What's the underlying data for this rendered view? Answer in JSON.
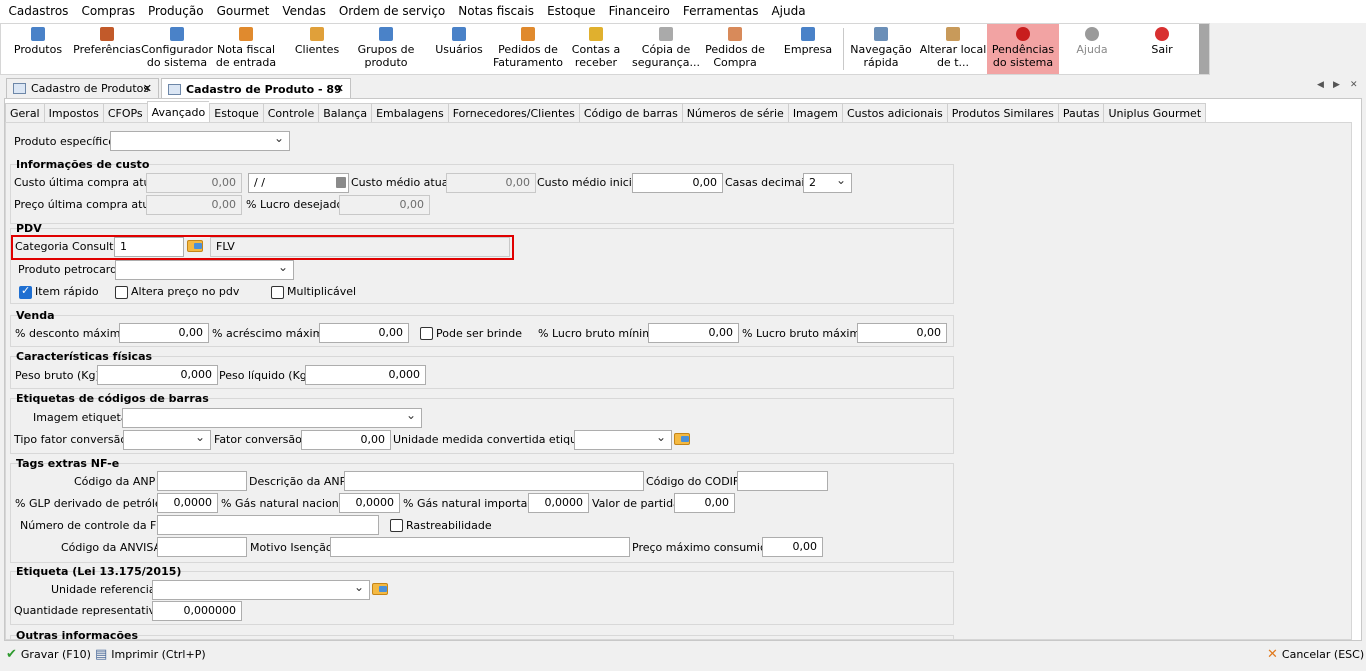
{
  "menu": [
    "Cadastros",
    "Compras",
    "Produção",
    "Gourmet",
    "Vendas",
    "Ordem de serviço",
    "Notas fiscais",
    "Estoque",
    "Financeiro",
    "Ferramentas",
    "Ajuda"
  ],
  "toolbar": [
    {
      "label": "Produtos",
      "icon": "products-icon",
      "color": "#4a82c8"
    },
    {
      "label": "Preferências",
      "icon": "preferences-icon",
      "color": "#c25a2a"
    },
    {
      "label": "Configurador\ndo sistema",
      "icon": "configurator-icon",
      "color": "#4a82c8"
    },
    {
      "label": "Nota fiscal\nde entrada",
      "icon": "invoice-icon",
      "color": "#e08a2e"
    },
    {
      "label": "Clientes",
      "icon": "clients-icon",
      "color": "#e0a03a"
    },
    {
      "label": "Grupos de\nproduto",
      "icon": "product-groups-icon",
      "color": "#4a82c8"
    },
    {
      "label": "Usuários",
      "icon": "users-icon",
      "color": "#4a82c8"
    },
    {
      "label": "Pedidos de\nFaturamento",
      "icon": "billing-orders-icon",
      "color": "#e08a2e"
    },
    {
      "label": "Contas a\nreceber",
      "icon": "receivables-icon",
      "color": "#e0b02e"
    },
    {
      "label": "Cópia de\nsegurança...",
      "icon": "backup-icon",
      "color": "#aaaaaa"
    },
    {
      "label": "Pedidos de\nCompra",
      "icon": "purchase-orders-icon",
      "color": "#d88a5a"
    },
    {
      "label": "Empresa",
      "icon": "company-icon",
      "color": "#4a82c8"
    },
    {
      "label": "Navegação\nrápida",
      "icon": "quick-nav-icon",
      "color": "#6b8fb8"
    },
    {
      "label": "Alterar local\nde t...",
      "icon": "change-location-icon",
      "color": "#c89a5a"
    },
    {
      "label": "Pendências\ndo sistema",
      "icon": "alert-icon",
      "color": "#c81e1e"
    },
    {
      "label": "Ajuda",
      "icon": "help-icon",
      "color": "#9a9a9a"
    },
    {
      "label": "Sair",
      "icon": "power-icon",
      "color": "#d83030"
    }
  ],
  "doc_tabs": [
    {
      "label": "Cadastro de Produtos"
    },
    {
      "label": "Cadastro de Produto - 89"
    }
  ],
  "inner_tabs": [
    "Geral",
    "Impostos",
    "CFOPs",
    "Avançado",
    "Estoque",
    "Controle",
    "Balança",
    "Embalagens",
    "Fornecedores/Clientes",
    "Código de barras",
    "Números de série",
    "Imagem",
    "Custos adicionais",
    "Produtos Similares",
    "Pautas",
    "Uniplus Gourmet"
  ],
  "form": {
    "produto_especifico": {
      "label": "Produto específico:",
      "value": ""
    },
    "custo": {
      "title": "Informações de custo",
      "custo_ultima_compra_label": "Custo última compra atual:",
      "custo_ultima_compra": "0,00",
      "data": " / /",
      "custo_medio_label": "Custo médio atual:",
      "custo_medio": "0,00",
      "custo_medio_inicial_label": "Custo médio inicial:",
      "custo_medio_inicial": "0,00",
      "casas_decimais_label": "Casas decimais:",
      "casas_decimais": "2",
      "preco_ultima_compra_label": "Preço última compra atual:",
      "preco_ultima_compra": "0,00",
      "lucro_desejado_label": "% Lucro desejado:",
      "lucro_desejado": "0,00"
    },
    "pdv": {
      "title": "PDV",
      "categoria_label": "Categoria Consulta:",
      "categoria_code": "1",
      "categoria_name": "FLV",
      "petrocard_label": "Produto petrocard:",
      "petrocard": "",
      "item_rapido_label": "Item rápido",
      "item_rapido": true,
      "altera_preco_label": "Altera preço no pdv",
      "altera_preco": false,
      "multiplicavel_label": "Multiplicável",
      "multiplicavel": false
    },
    "venda": {
      "title": "Venda",
      "desc_max_label": "% desconto máximo:",
      "desc_max": "0,00",
      "acresc_max_label": "% acréscimo máximo:",
      "acresc_max": "0,00",
      "brinde_label": "Pode ser brinde",
      "brinde": false,
      "lucro_min_label": "% Lucro bruto mínimo:",
      "lucro_min": "0,00",
      "lucro_max_label": "% Lucro bruto máximo:",
      "lucro_max": "0,00"
    },
    "fisicas": {
      "title": "Características físicas",
      "peso_bruto_label": "Peso bruto (Kg):",
      "peso_bruto": "0,000",
      "peso_liquido_label": "Peso líquido (Kg):",
      "peso_liquido": "0,000"
    },
    "etiquetas": {
      "title": "Etiquetas de códigos de barras",
      "imagem_label": "Imagem etiqueta:",
      "imagem": "",
      "tipo_fator_label": "Tipo fator conversão:",
      "tipo_fator": "",
      "fator_label": "Fator conversão:",
      "fator": "0,00",
      "unidade_label": "Unidade medida convertida etiqueta:",
      "unidade": ""
    },
    "nfe": {
      "title": "Tags extras NF-e",
      "cod_anp_label": "Código da ANP :",
      "cod_anp": "",
      "desc_anp_label": "Descrição da ANP :",
      "desc_anp": "",
      "codif_label": "Código do CODIF:",
      "codif": "",
      "glp_label": "% GLP derivado de petróleo:",
      "glp": "0,0000",
      "gn_nac_label": "% Gás natural nacional:",
      "gn_nac": "0,0000",
      "gn_imp_label": "% Gás natural importado:",
      "gn_imp": "0,0000",
      "valor_partida_label": "Valor de partida:",
      "valor_partida": "0,00",
      "fci_label": "Número de controle da FCI:",
      "fci": "",
      "rastreabilidade_label": "Rastreabilidade",
      "rastreabilidade": false,
      "anvisa_label": "Código da ANVISA:",
      "anvisa": "",
      "motivo_label": "Motivo Isenção:",
      "motivo": "",
      "preco_max_label": "Preço máximo consumidor:",
      "preco_max": "0,00"
    },
    "etiqueta_lei": {
      "title": "Etiqueta (Lei 13.175/2015)",
      "unidade_ref_label": "Unidade referencial:",
      "unidade_ref": "",
      "qtd_rep_label": "Quantidade representativa:",
      "qtd_rep": "0,000000"
    },
    "outras": {
      "title": "Outras informações"
    }
  },
  "status": {
    "gravar": "Gravar (F10)",
    "imprimir": "Imprimir (Ctrl+P)",
    "cancelar": "Cancelar (ESC)"
  }
}
